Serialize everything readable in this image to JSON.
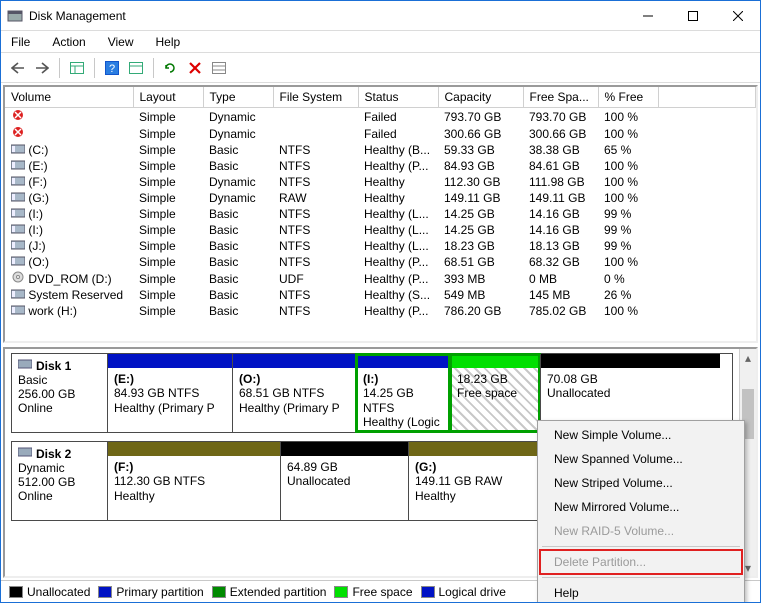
{
  "window": {
    "title": "Disk Management"
  },
  "menu": {
    "file": "File",
    "action": "Action",
    "view": "View",
    "help": "Help"
  },
  "columns": [
    "Volume",
    "Layout",
    "Type",
    "File System",
    "Status",
    "Capacity",
    "Free Spa...",
    "% Free"
  ],
  "volumes": [
    {
      "icon": "err",
      "name": "",
      "layout": "Simple",
      "type": "Dynamic",
      "fs": "",
      "status": "Failed",
      "cap": "793.70 GB",
      "free": "793.70 GB",
      "pct": "100 %"
    },
    {
      "icon": "err",
      "name": "",
      "layout": "Simple",
      "type": "Dynamic",
      "fs": "",
      "status": "Failed",
      "cap": "300.66 GB",
      "free": "300.66 GB",
      "pct": "100 %"
    },
    {
      "icon": "vol",
      "name": "(C:)",
      "layout": "Simple",
      "type": "Basic",
      "fs": "NTFS",
      "status": "Healthy (B...",
      "cap": "59.33 GB",
      "free": "38.38 GB",
      "pct": "65 %"
    },
    {
      "icon": "vol",
      "name": "(E:)",
      "layout": "Simple",
      "type": "Basic",
      "fs": "NTFS",
      "status": "Healthy (P...",
      "cap": "84.93 GB",
      "free": "84.61 GB",
      "pct": "100 %"
    },
    {
      "icon": "vol",
      "name": "(F:)",
      "layout": "Simple",
      "type": "Dynamic",
      "fs": "NTFS",
      "status": "Healthy",
      "cap": "112.30 GB",
      "free": "111.98 GB",
      "pct": "100 %"
    },
    {
      "icon": "vol",
      "name": "(G:)",
      "layout": "Simple",
      "type": "Dynamic",
      "fs": "RAW",
      "status": "Healthy",
      "cap": "149.11 GB",
      "free": "149.11 GB",
      "pct": "100 %"
    },
    {
      "icon": "vol",
      "name": "(I:)",
      "layout": "Simple",
      "type": "Basic",
      "fs": "NTFS",
      "status": "Healthy (L...",
      "cap": "14.25 GB",
      "free": "14.16 GB",
      "pct": "99 %"
    },
    {
      "icon": "vol",
      "name": "(I:)",
      "layout": "Simple",
      "type": "Basic",
      "fs": "NTFS",
      "status": "Healthy (L...",
      "cap": "14.25 GB",
      "free": "14.16 GB",
      "pct": "99 %"
    },
    {
      "icon": "vol",
      "name": "(J:)",
      "layout": "Simple",
      "type": "Basic",
      "fs": "NTFS",
      "status": "Healthy (L...",
      "cap": "18.23 GB",
      "free": "18.13 GB",
      "pct": "99 %"
    },
    {
      "icon": "vol",
      "name": "(O:)",
      "layout": "Simple",
      "type": "Basic",
      "fs": "NTFS",
      "status": "Healthy (P...",
      "cap": "68.51 GB",
      "free": "68.32 GB",
      "pct": "100 %"
    },
    {
      "icon": "dvd",
      "name": "DVD_ROM (D:)",
      "layout": "Simple",
      "type": "Basic",
      "fs": "UDF",
      "status": "Healthy (P...",
      "cap": "393 MB",
      "free": "0 MB",
      "pct": "0 %"
    },
    {
      "icon": "vol",
      "name": "System Reserved",
      "layout": "Simple",
      "type": "Basic",
      "fs": "NTFS",
      "status": "Healthy (S...",
      "cap": "549 MB",
      "free": "145 MB",
      "pct": "26 %"
    },
    {
      "icon": "vol",
      "name": "work (H:)",
      "layout": "Simple",
      "type": "Basic",
      "fs": "NTFS",
      "status": "Healthy (P...",
      "cap": "786.20 GB",
      "free": "785.02 GB",
      "pct": "100 %"
    }
  ],
  "disk1": {
    "name": "Disk 1",
    "kind": "Basic",
    "size": "256.00 GB",
    "state": "Online",
    "p0": {
      "label": "(E:)",
      "l2": "84.93 GB NTFS",
      "l3": "Healthy (Primary P"
    },
    "p1": {
      "label": "(O:)",
      "l2": "68.51 GB NTFS",
      "l3": "Healthy (Primary P"
    },
    "p2": {
      "label": "(I:)",
      "l2": "14.25 GB NTFS",
      "l3": "Healthy (Logic"
    },
    "p3": {
      "label": "",
      "l2": "18.23 GB",
      "l3": "Free space"
    },
    "p4": {
      "label": "",
      "l2": "70.08 GB",
      "l3": "Unallocated"
    }
  },
  "disk2": {
    "name": "Disk 2",
    "kind": "Dynamic",
    "size": "512.00 GB",
    "state": "Online",
    "p0": {
      "label": "(F:)",
      "l2": "112.30 GB NTFS",
      "l3": "Healthy"
    },
    "p1": {
      "label": "",
      "l2": "64.89 GB",
      "l3": "Unallocated"
    },
    "p2": {
      "label": "(G:)",
      "l2": "149.11 GB RAW",
      "l3": "Healthy"
    }
  },
  "legend": {
    "unalloc": "Unallocated",
    "primary": "Primary partition",
    "ext": "Extended partition",
    "free": "Free space",
    "logical": "Logical drive"
  },
  "ctx": {
    "newSimple": "New Simple Volume...",
    "newSpanned": "New Spanned Volume...",
    "newStriped": "New Striped Volume...",
    "newMirrored": "New Mirrored Volume...",
    "newRaid5": "New RAID-5 Volume...",
    "delete": "Delete Partition...",
    "help": "Help"
  }
}
